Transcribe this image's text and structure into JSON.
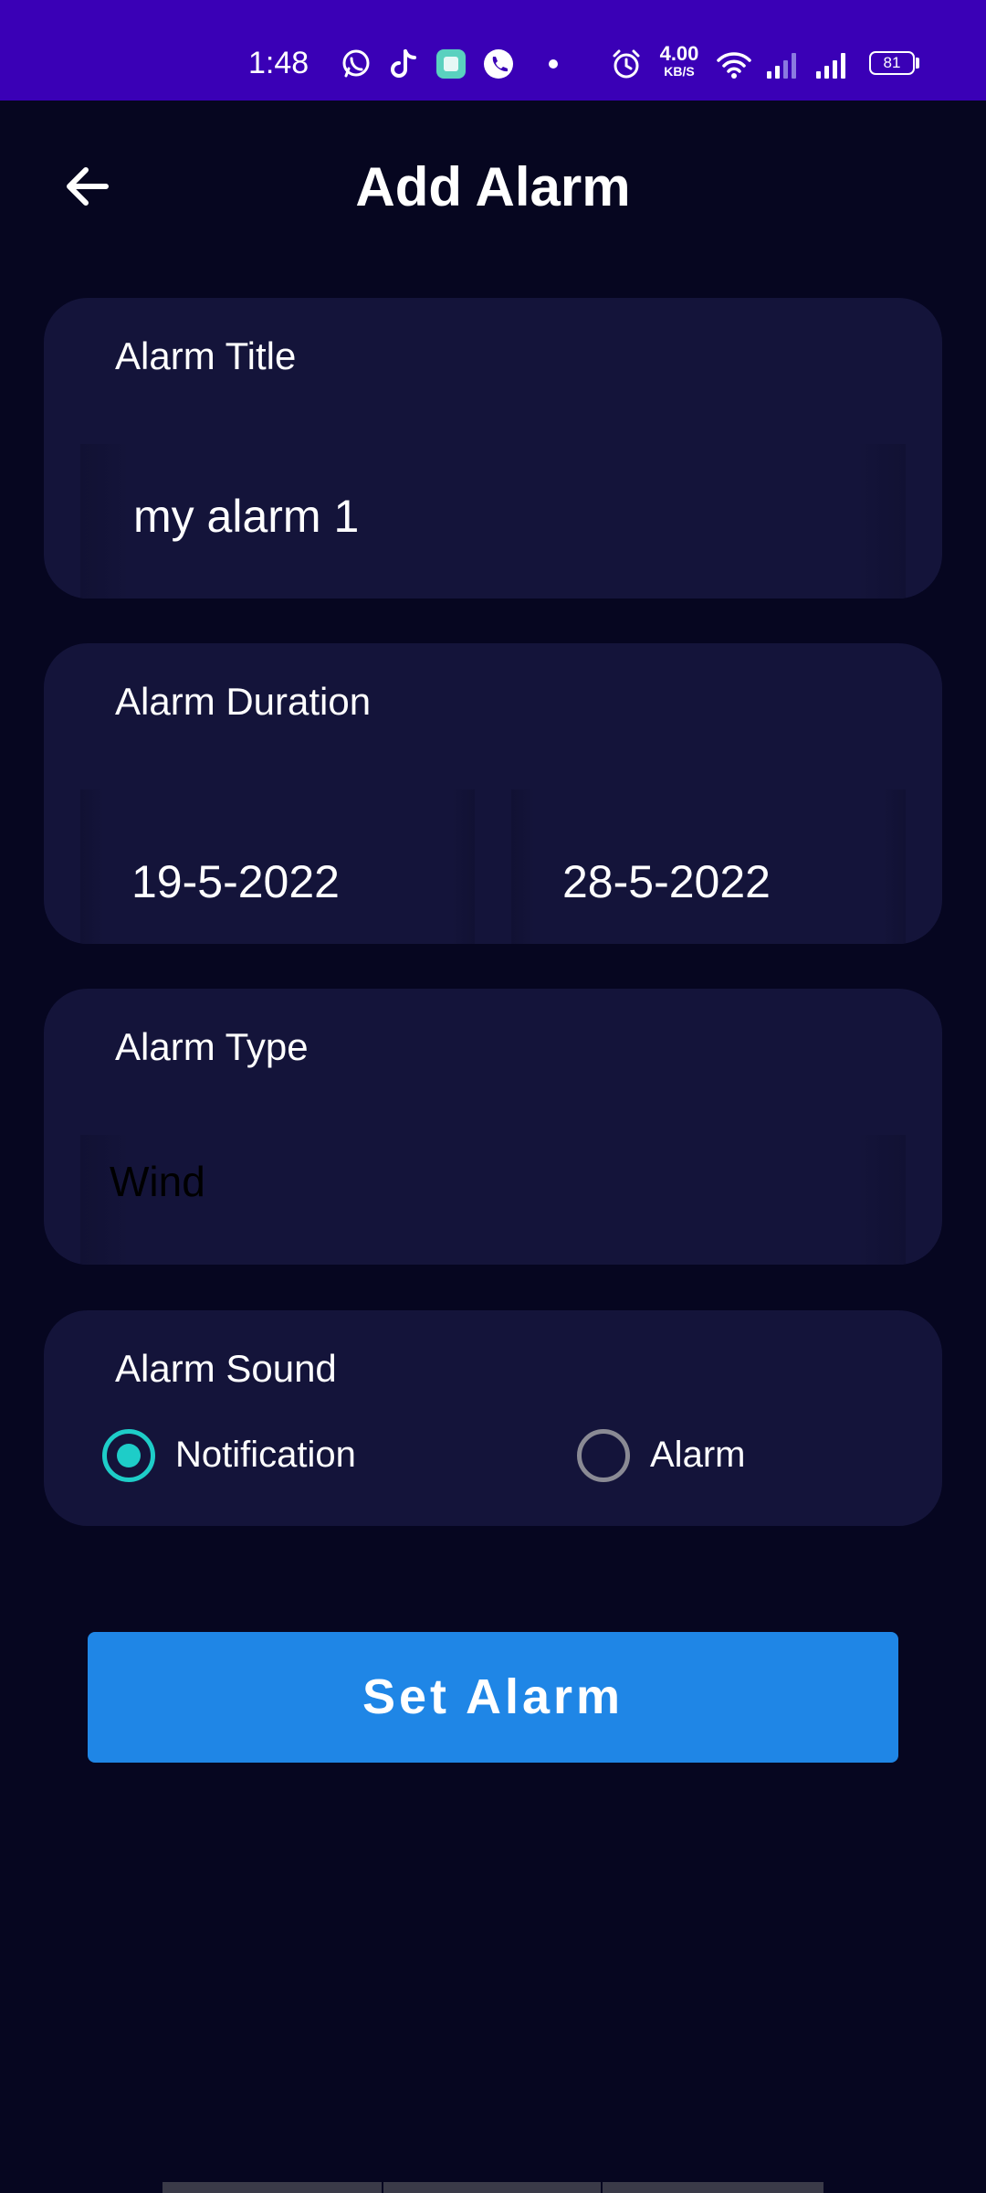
{
  "status_bar": {
    "time": "1:48",
    "net_speed_value": "4.00",
    "net_speed_unit": "KB/S",
    "battery": "81",
    "color": "#3a00b6"
  },
  "header": {
    "title": "Add Alarm",
    "back_icon": "arrow-left-icon"
  },
  "alarm_title": {
    "label": "Alarm Title",
    "value": "my alarm 1"
  },
  "alarm_duration": {
    "label": "Alarm Duration",
    "start_date": "19-5-2022",
    "end_date": "28-5-2022"
  },
  "alarm_type": {
    "label": "Alarm Type",
    "value": "Wind"
  },
  "alarm_sound": {
    "label": "Alarm Sound",
    "options": [
      {
        "label": "Notification",
        "selected": true
      },
      {
        "label": "Alarm",
        "selected": false
      }
    ]
  },
  "actions": {
    "set_alarm_label": "Set Alarm",
    "button_color": "#1f86e6"
  },
  "colors": {
    "background": "#060620",
    "card": "#14143a",
    "radio_accent": "#1ecdc8"
  }
}
